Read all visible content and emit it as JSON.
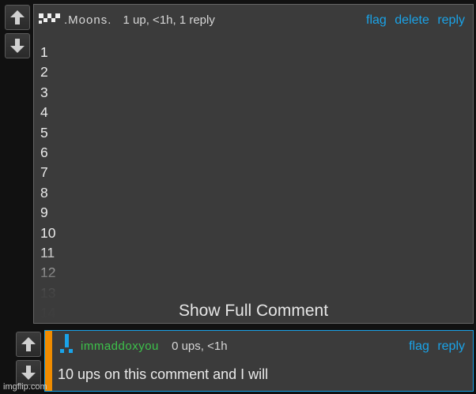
{
  "comment1": {
    "username": ".Moons.",
    "meta": "1 up, <1h, 1 reply",
    "actions": {
      "flag": "flag",
      "delete": "delete",
      "reply": "reply"
    },
    "lines": [
      "1",
      "2",
      "3",
      "4",
      "5",
      "6",
      "7",
      "8",
      "9",
      "10",
      "11",
      "12",
      "13",
      "14"
    ],
    "show_full": "Show Full Comment"
  },
  "comment2": {
    "username": "immaddoxyou",
    "meta": "0 ups, <1h",
    "actions": {
      "flag": "flag",
      "reply": "reply"
    },
    "text": "10 ups on this comment and I will"
  },
  "watermark": "imgflip.com",
  "colors": {
    "link": "#1aa3e8",
    "username2": "#3cc24a",
    "op_bar": "#f08c00"
  },
  "icons": [
    "upvote-arrow-icon",
    "downvote-arrow-icon",
    "user-avatar-icon"
  ]
}
